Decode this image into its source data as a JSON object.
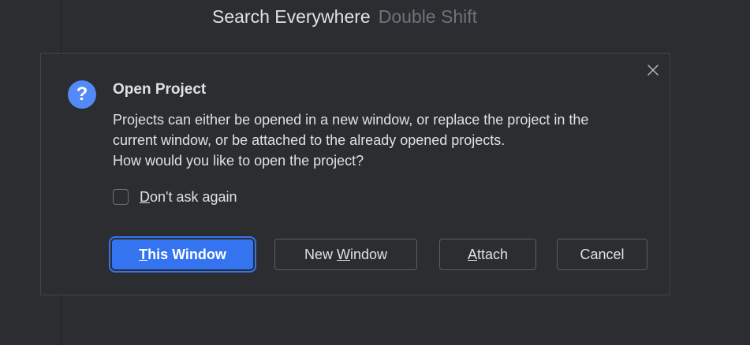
{
  "background": {
    "hint": {
      "action": "Search Everywhere",
      "shortcut": "Double Shift"
    }
  },
  "dialog": {
    "icon": "question-icon",
    "icon_glyph": "?",
    "title": "Open Project",
    "message_lines": [
      "Projects can either be opened in a new window, or replace the project in the",
      "current window, or be attached to the already opened projects.",
      "How would you like to open the project?"
    ],
    "checkbox": {
      "mnemonic": "D",
      "label_rest": "on't ask again",
      "checked": false
    },
    "close_icon": "close-icon",
    "buttons": {
      "this_window": {
        "mnemonic": "T",
        "rest": "his Window",
        "default": true
      },
      "new_window": {
        "before": "New ",
        "mnemonic": "W",
        "rest": "indow"
      },
      "attach": {
        "mnemonic": "A",
        "rest": "ttach"
      },
      "cancel": {
        "label": "Cancel"
      }
    }
  },
  "colors": {
    "accent": "#3574f0",
    "icon_blue": "#548af7",
    "background": "#2b2d31",
    "text": "#dfe1e5",
    "muted_text": "#6f737a"
  }
}
